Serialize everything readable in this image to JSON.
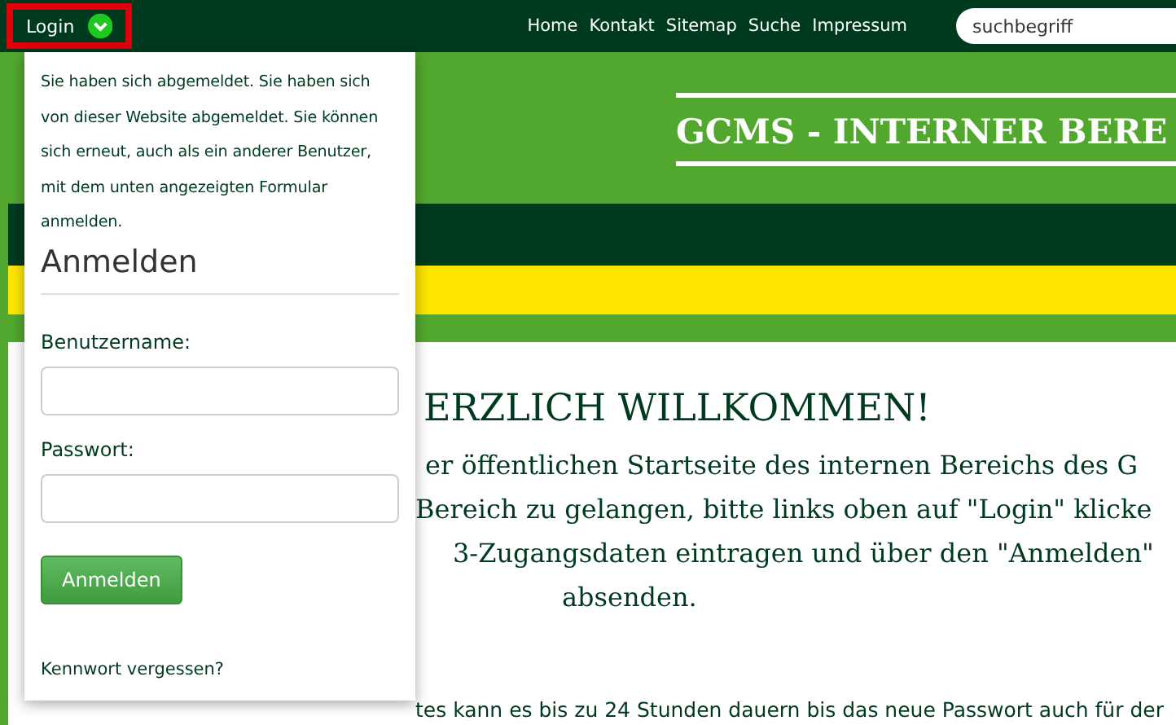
{
  "topbar": {
    "login_button": {
      "label": "Login",
      "expanded": true
    },
    "nav": [
      "Home",
      "Kontakt",
      "Sitemap",
      "Suche",
      "Impressum"
    ],
    "search": {
      "placeholder": "suchbegriff"
    }
  },
  "header": {
    "title": "GCMS - INTERNER BERE"
  },
  "login_dropdown": {
    "message": "Sie haben sich abgemeldet. Sie haben sich von dieser Website abgemeldet. Sie können sich erneut, auch als ein anderer Benutzer, mit dem unten angezeigten Formular anmelden.",
    "heading": "Anmelden",
    "fields": [
      {
        "label": "Benutzername:"
      },
      {
        "label": "Passwort:"
      }
    ],
    "submit": "Anmelden",
    "forgot_link": "Kennwort vergessen?"
  },
  "content": {
    "heading": "ERZLICH WILLKOMMEN!",
    "lines": [
      "er öffentlichen Startseite des internen Bereichs des G",
      "Bereich zu gelangen, bitte links oben auf \"Login\" klicke",
      "3-Zugangsdaten eintragen und über den \"Anmelden\"",
      "absenden."
    ],
    "note": "tes kann es bis zu 24 Stunden dauern bis das neue Passwort auch für der"
  }
}
